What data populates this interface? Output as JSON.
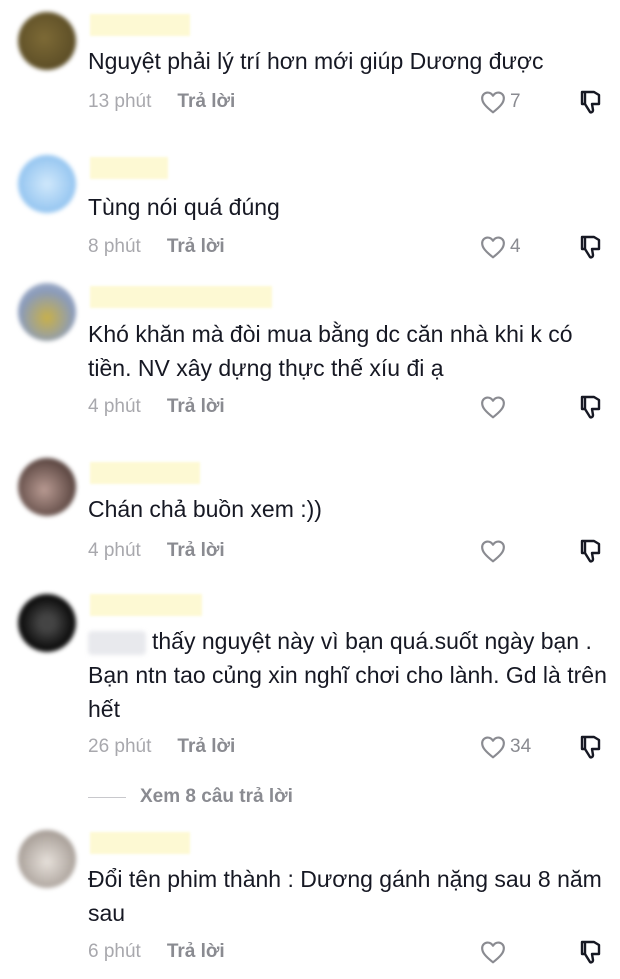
{
  "comments": [
    {
      "text": "Nguyệt phải lý trí hơn mới giúp Dương được",
      "time": "13 phút",
      "reply": "Trả lời",
      "likes": "7",
      "avatar_color": "#6b5a2d"
    },
    {
      "text": "Tùng nói quá đúng",
      "time": "8 phút",
      "reply": "Trả lời",
      "likes": "4",
      "avatar_color": "#8fc4f0"
    },
    {
      "text": "Khó khăn mà đòi mua bằng dc căn nhà khi k có tiền. NV xây dựng thực thế xíu đi ạ",
      "time": "4 phút",
      "reply": "Trả lời",
      "likes": "",
      "avatar_color": "#9aa9c2"
    },
    {
      "text": "Chán chả buồn xem :))",
      "time": "4 phút",
      "reply": "Trả lời",
      "likes": "",
      "avatar_color": "#6a5550"
    },
    {
      "text": "thấy nguyệt này vì bạn quá.suốt ngày bạn . Bạn ntn tao củng xin nghĩ chơi cho lành. Gd là trên hết",
      "time": "26 phút",
      "reply": "Trả lời",
      "likes": "34",
      "avatar_color": "#1c1c1c"
    },
    {
      "text": "Đổi tên phim thành : Dương gánh nặng sau 8 năm sau",
      "time": "6 phút",
      "reply": "Trả lời",
      "likes": "",
      "avatar_color": "#c9c2bd"
    }
  ],
  "view_replies": "Xem 8 câu trả lời",
  "icons": {
    "like": "heart-outline-icon",
    "dislike": "thumbs-down-icon"
  }
}
